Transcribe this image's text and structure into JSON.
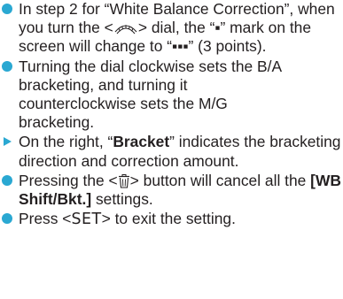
{
  "items": [
    {
      "marker": "bullet",
      "segments": {
        "a": "In step 2 for “White Balance Correction”, when you turn the <",
        "dial_icon": "main-dial-icon",
        "b": "> dial, the “",
        "mark1": "▪",
        "c": "” mark on the screen will change to “",
        "mark3": "▪▪▪",
        "d": "” (3 points)."
      }
    },
    {
      "marker": "bullet",
      "text": "Turning the dial clockwise sets the B/A bracketing, and turning it counterclockwise sets the M/G bracketing."
    },
    {
      "marker": "triangle",
      "segments": {
        "a": "On the right, “",
        "bold": "Bracket",
        "b": "” indicates the bracketing direction and correction amount."
      }
    },
    {
      "marker": "bullet",
      "segments": {
        "a": "Pressing the <",
        "trash_icon": "erase-button-icon",
        "b": "> button will cancel all the ",
        "bold": "[WB Shift/Bkt.]",
        "c": " settings."
      }
    },
    {
      "marker": "bullet",
      "segments": {
        "a": "Press <",
        "set": "SET",
        "b": "> to exit the setting."
      }
    }
  ],
  "colors": {
    "marker": "#2aa8d2",
    "text": "#231f20"
  }
}
